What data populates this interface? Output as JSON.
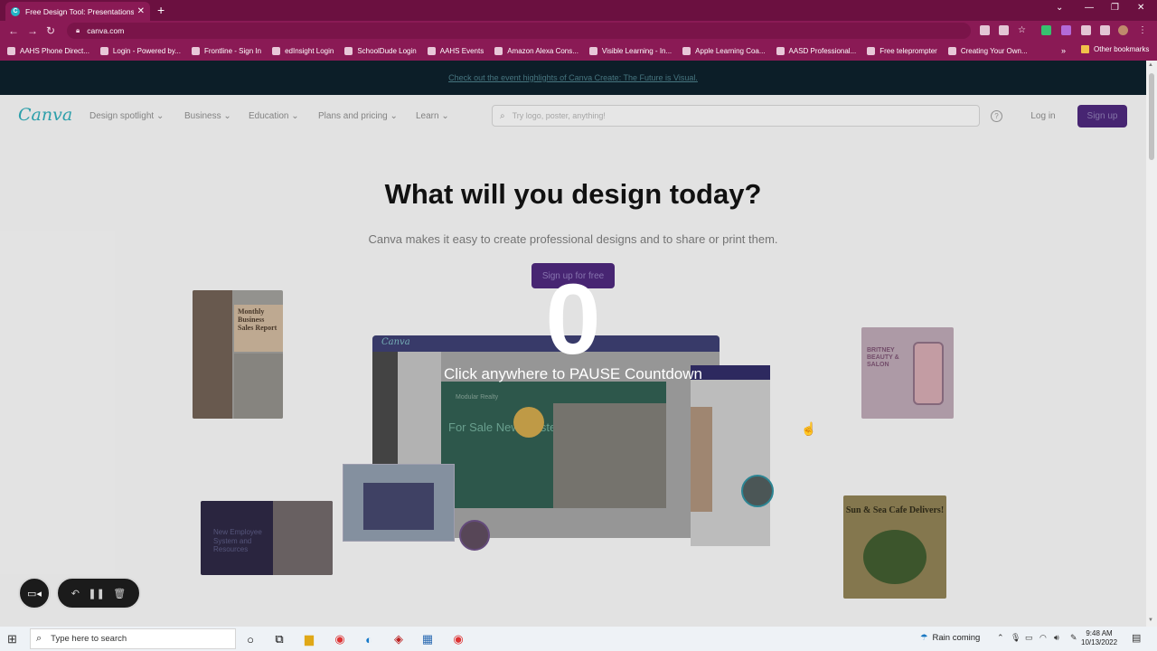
{
  "browser": {
    "tab_title": "Free Design Tool: Presentations, V",
    "tab_close": "✕",
    "new_tab": "+",
    "url": "canva.com",
    "bookmarks": [
      "AAHS Phone Direct...",
      "Login - Powered by...",
      "Frontline - Sign In",
      "edInsight Login",
      "SchoolDude Login",
      "AAHS Events",
      "Amazon Alexa Cons...",
      "Visible Learning - In...",
      "Apple Learning Coa...",
      "AASD Professional...",
      "Free teleprompter",
      "Creating Your Own..."
    ],
    "bookmarks_more": "»",
    "other_bookmarks": "Other bookmarks"
  },
  "page": {
    "banner": "Check out the event highlights of Canva Create: The Future is Visual.",
    "logo": "Canva",
    "menu": [
      "Design spotlight",
      "Business",
      "Education",
      "Plans and pricing",
      "Learn"
    ],
    "search_placeholder": "Try logo, poster, anything!",
    "help": "?",
    "login": "Log in",
    "signup": "Sign up",
    "headline": "What will you design today?",
    "subheadline": "Canva makes it easy to create professional designs and to share or print them.",
    "hero_button": "Sign up for free",
    "mock_logo": "Canva",
    "cards": {
      "report": "Monthly Business Sales Report",
      "realty": "Modular Realty",
      "for_sale": "For Sale Newly Listed",
      "salon": "BRITNEY BEAUTY & SALON",
      "employee": "New Employee System and Resources",
      "cafe": "Sun & Sea Cafe Delivers!"
    }
  },
  "overlay": {
    "countdown": "0",
    "message": "Click anywhere to PAUSE Countdown"
  },
  "taskbar": {
    "search_placeholder": "Type here to search",
    "weather": "Rain coming",
    "time": "9:48 AM",
    "date": "10/13/2022"
  }
}
